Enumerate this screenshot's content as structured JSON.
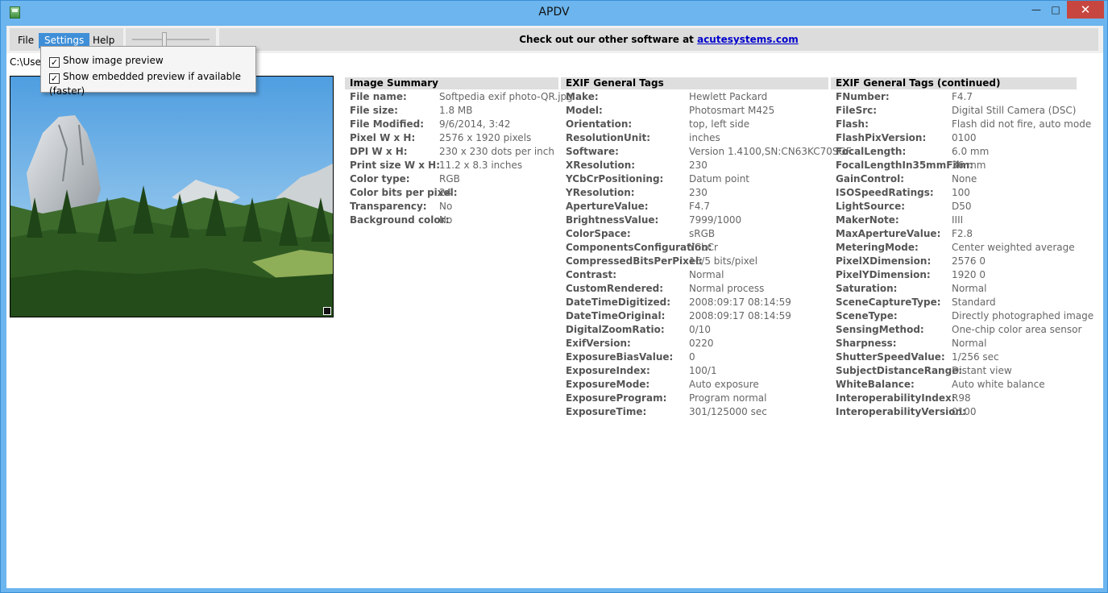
{
  "window": {
    "title": "APDV",
    "minimize": "—",
    "maximize": "□",
    "close": "✕"
  },
  "menu": {
    "file": "File",
    "settings": "Settings",
    "help": "Help"
  },
  "banner": {
    "text": "Check out our other software at ",
    "link": "acutesystems.com"
  },
  "path": "C:\\User",
  "settings_menu": {
    "items": [
      {
        "label": "Show image preview",
        "checked": true
      },
      {
        "label": "Show embedded preview if available (faster)",
        "checked": true
      }
    ]
  },
  "image_summary": {
    "title": "Image Summary",
    "rows": [
      {
        "k": "File name:",
        "v": "Softpedia exif photo-QR.jpg"
      },
      {
        "k": "File size:",
        "v": "1.8 MB"
      },
      {
        "k": "File Modified:",
        "v": "9/6/2014, 3:42"
      },
      {
        "k": "Pixel W x H:",
        "v": "2576 x 1920 pixels"
      },
      {
        "k": "DPI W x H:",
        "v": "230 x 230 dots per inch"
      },
      {
        "k": "Print size W x H:",
        "v": "11.2 x 8.3 inches"
      },
      {
        "k": "Color type:",
        "v": "RGB"
      },
      {
        "k": "Color bits per pixel:",
        "v": "24"
      },
      {
        "k": "Transparency:",
        "v": "No"
      },
      {
        "k": "Background color:",
        "v": "No"
      }
    ]
  },
  "exif_general": {
    "title": "EXIF General Tags",
    "rows": [
      {
        "k": "Make:",
        "v": "Hewlett Packard"
      },
      {
        "k": "Model:",
        "v": "Photosmart M425"
      },
      {
        "k": "Orientation:",
        "v": "top, left side"
      },
      {
        "k": "ResolutionUnit:",
        "v": "inches"
      },
      {
        "k": "Software:",
        "v": "Version 1.4100,SN:CN63KC70SGF"
      },
      {
        "k": "XResolution:",
        "v": "230"
      },
      {
        "k": "YCbCrPositioning:",
        "v": "Datum point"
      },
      {
        "k": "YResolution:",
        "v": "230"
      },
      {
        "k": "ApertureValue:",
        "v": "F4.7"
      },
      {
        "k": "BrightnessValue:",
        "v": "7999/1000"
      },
      {
        "k": "ColorSpace:",
        "v": "sRGB"
      },
      {
        "k": "ComponentsConfiguration:",
        "v": "YCbCr"
      },
      {
        "k": "CompressedBitsPerPixel:",
        "v": "16/5 bits/pixel"
      },
      {
        "k": "Contrast:",
        "v": "Normal"
      },
      {
        "k": "CustomRendered:",
        "v": "Normal process"
      },
      {
        "k": "DateTimeDigitized:",
        "v": "2008:09:17 08:14:59"
      },
      {
        "k": "DateTimeOriginal:",
        "v": "2008:09:17 08:14:59"
      },
      {
        "k": "DigitalZoomRatio:",
        "v": "0/10"
      },
      {
        "k": "ExifVersion:",
        "v": "0220"
      },
      {
        "k": "ExposureBiasValue:",
        "v": "0"
      },
      {
        "k": "ExposureIndex:",
        "v": "100/1"
      },
      {
        "k": "ExposureMode:",
        "v": "Auto exposure"
      },
      {
        "k": "ExposureProgram:",
        "v": "Program normal"
      },
      {
        "k": "ExposureTime:",
        "v": "301/125000 sec"
      }
    ]
  },
  "exif_continued": {
    "title": "EXIF General Tags (continued)",
    "rows": [
      {
        "k": "FNumber:",
        "v": "F4.7"
      },
      {
        "k": "FileSrc:",
        "v": "Digital Still Camera (DSC)"
      },
      {
        "k": "Flash:",
        "v": "Flash did not fire, auto mode"
      },
      {
        "k": "FlashPixVersion:",
        "v": "0100"
      },
      {
        "k": "FocalLength:",
        "v": "6.0 mm"
      },
      {
        "k": "FocalLengthIn35mmFilm:",
        "v": "36 mm"
      },
      {
        "k": "GainControl:",
        "v": "None"
      },
      {
        "k": "ISOSpeedRatings:",
        "v": "100"
      },
      {
        "k": "LightSource:",
        "v": "D50"
      },
      {
        "k": "MakerNote:",
        "v": "IIII"
      },
      {
        "k": "MaxApertureValue:",
        "v": "F2.8"
      },
      {
        "k": "MeteringMode:",
        "v": "Center weighted average"
      },
      {
        "k": "PixelXDimension:",
        "v": "2576 0"
      },
      {
        "k": "PixelYDimension:",
        "v": "1920 0"
      },
      {
        "k": "Saturation:",
        "v": "Normal"
      },
      {
        "k": "SceneCaptureType:",
        "v": "Standard"
      },
      {
        "k": "SceneType:",
        "v": "Directly photographed image"
      },
      {
        "k": "SensingMethod:",
        "v": "One-chip color area sensor"
      },
      {
        "k": "Sharpness:",
        "v": "Normal"
      },
      {
        "k": "ShutterSpeedValue:",
        "v": "1/256 sec"
      },
      {
        "k": "SubjectDistanceRange:",
        "v": "Distant view"
      },
      {
        "k": "WhiteBalance:",
        "v": "Auto white balance"
      },
      {
        "k": "InteroperabilityIndex:",
        "v": "R98"
      },
      {
        "k": "InteroperabilityVersion:",
        "v": "0100"
      }
    ]
  }
}
